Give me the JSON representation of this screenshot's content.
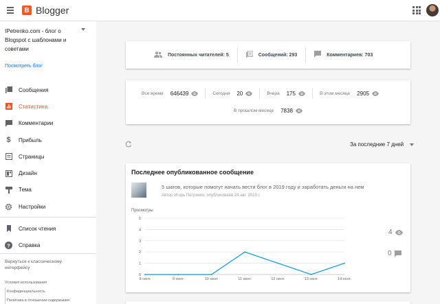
{
  "app": {
    "name": "Blogger"
  },
  "sidebar": {
    "blog_title": "IPetrenko.com - блог о Blogspot с шаблонами и советами",
    "view_blog": "Посмотреть блог",
    "items": [
      {
        "label": "Сообщения",
        "icon": "posts-icon"
      },
      {
        "label": "Статистика",
        "icon": "stats-icon",
        "active": true
      },
      {
        "label": "Комментарии",
        "icon": "comment-icon"
      },
      {
        "label": "Прибыль",
        "icon": "dollar-icon"
      },
      {
        "label": "Страницы",
        "icon": "pages-icon"
      },
      {
        "label": "Дизайн",
        "icon": "layout-icon"
      },
      {
        "label": "Тема",
        "icon": "theme-icon"
      },
      {
        "label": "Настройки",
        "icon": "gear-icon"
      }
    ],
    "items2": [
      {
        "label": "Список чтения",
        "icon": "bookmark-icon"
      },
      {
        "label": "Справка",
        "icon": "help-icon"
      }
    ],
    "classic": "Вернуться к классическому интерфейсу",
    "footer": {
      "terms": "Условия использования",
      "privacy": "Конфиденциальность",
      "content_policy": "Политика в отношении содержания"
    }
  },
  "summary": {
    "followers": "Постоянных читателей: 5",
    "posts": "Сообщений: 293",
    "comments": "Комментариев: 703"
  },
  "views": {
    "all_time_label": "Все время",
    "all_time": "646439",
    "today_label": "Сегодня",
    "today": "20",
    "yesterday_label": "Вчера",
    "yesterday": "175",
    "this_month_label": "В этом месяце",
    "this_month": "2905",
    "last_month_label": "В прошлом месяце",
    "last_month": "7838"
  },
  "period": {
    "label": "За последние 7 дней"
  },
  "latest_post": {
    "heading": "Последнее опубликованное сообщение",
    "title": "5 шагов, которые помогут начать вести блог в 2019 году и заработать деньги на нем",
    "meta": "Автор Игорь Петренко, опубликовано 24 авг. 2019 г.",
    "views_label": "Просмотры",
    "views_total": "4",
    "comments_total": "0"
  },
  "chart_data": {
    "type": "line",
    "categories": [
      "8 сент.",
      "9 сент.",
      "10 сент.",
      "11 сент.",
      "12 сент.",
      "13 сент.",
      "14 сент."
    ],
    "values": [
      0,
      0,
      0,
      2,
      1,
      0,
      1
    ],
    "ylabel": "Просмотры",
    "ylim": [
      0,
      5
    ],
    "yticks": [
      "0",
      "1",
      "2",
      "3",
      "4",
      "5"
    ],
    "grid": true,
    "color": "#039be5"
  },
  "colors": {
    "accent": "#f4511e",
    "link": "#1976d2",
    "line": "#039be5"
  }
}
